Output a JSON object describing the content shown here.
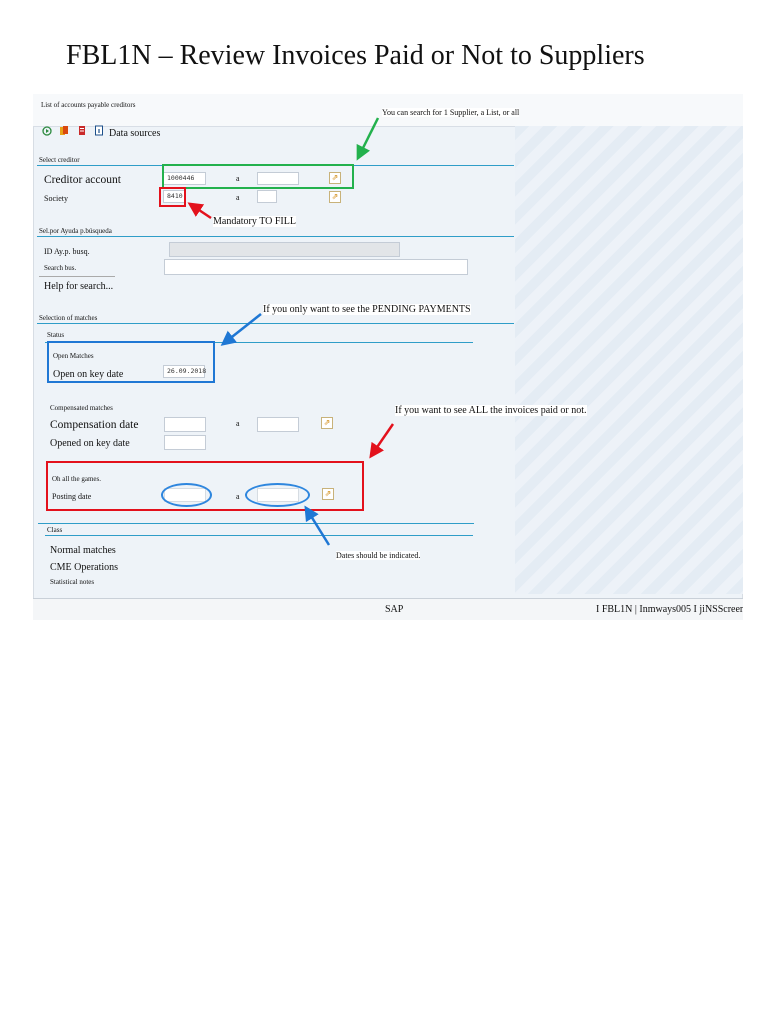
{
  "slide": {
    "title": "FBL1N – Review Invoices Paid or Not to Suppliers"
  },
  "sap": {
    "window_title": "List of accounts payable creditors",
    "toolbar": {
      "data_sources": "Data sources"
    },
    "select_creditor": {
      "header": "Select creditor",
      "creditor_account_label": "Creditor account",
      "creditor_account_value": "1000446",
      "to_label": "a",
      "society_label": "Society",
      "society_value": "8410"
    },
    "help_search": {
      "header": "Sel.por Ayuda p.búsqueda",
      "id_label": "ID Ay.p. busq.",
      "search_label": "Search bus.",
      "help_label": "Help for search..."
    },
    "selection": {
      "header": "Selection of matches",
      "status_label": "Status",
      "open_matches": "Open Matches",
      "open_on_key_date_label": "Open on key date",
      "open_on_key_date_value": "26.09.2018",
      "compensated_matches": "Compensated matches",
      "compensation_date_label": "Compensation date",
      "to_label": "a",
      "opened_on_key_date_label": "Opened on key date",
      "all_games": "Oh all the games.",
      "posting_date_label": "Posting date"
    },
    "class": {
      "header": "Class",
      "normal_matches": "Normal matches",
      "cme_operations": "CME Operations",
      "statistical_notes": "Statistical notes"
    },
    "status_bar": {
      "sap": "SAP",
      "info": "I FBL1N | Inmways005 I jiNSScreen"
    }
  },
  "annotations": {
    "search_note": "You can search for 1 Supplier, a List, or all",
    "mandatory": "Mandatory TO FILL",
    "pending": "If you only want to see the PENDING PAYMENTS",
    "all_paid": "If you want to see ALL the invoices paid or not.",
    "dates": "Dates should be indicated."
  },
  "colors": {
    "green_box": "#23b14d",
    "red_box": "#e3111c",
    "blue_box": "#1f77d4",
    "section_line": "#2f9dc8"
  }
}
